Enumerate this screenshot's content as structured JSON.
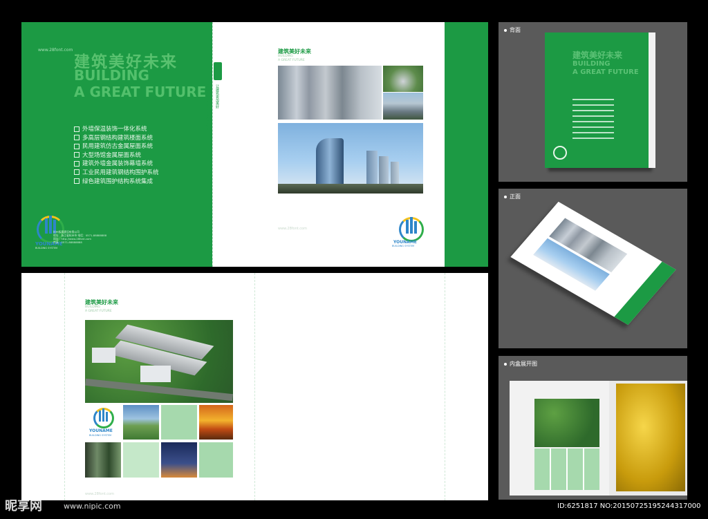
{
  "cover": {
    "url": "www.28font.com",
    "cn_title": "建筑美好未来",
    "en_line1": "BUILDING",
    "en_line2": "A GREAT FUTURE",
    "features": [
      "外墙保温装饰一体化系统",
      "多高层钢结构建筑楼面系统",
      "民用建筑仿古金属屋面系统",
      "大型场馆金属屋面系统",
      "建筑外墙金属装饰幕墙系统",
      "工业民用建筑钢结构围护系统",
      "绿色建筑围护结构系统集成"
    ],
    "brand": "YOUNAME",
    "brand_sub": "BUILDING SYSTEM",
    "company_lines": [
      "杭州板康建设有限公司",
      "地址：浙江省杭州市 电话：0571-88888888",
      "网址：http://www.28font.com",
      "传真：0571-88888888"
    ]
  },
  "spine": {
    "text_cn": "让建筑更加美好",
    "text_en": "Let the building speaking for you"
  },
  "front": {
    "cn_title": "建筑美好未来",
    "en_line1": "BUILDING",
    "en_line2": "A GREAT FUTURE",
    "url": "www.28font.com",
    "brand": "YOUNAME",
    "brand_sub": "BUILDING SYSTEM"
  },
  "inner": {
    "cn_title": "建筑美好未来",
    "en_line1": "BUILDING",
    "en_line2": "A GREAT FUTURE",
    "brand": "YOUNAME",
    "brand_sub": "BUILDING SYSTEM",
    "url": "www.28font.com"
  },
  "panels": {
    "back_label": "背面",
    "front_label": "正面",
    "open_label": "内盒展开图"
  },
  "mockup": {
    "cn_title": "建筑美好未来",
    "en_line1": "BUILDING",
    "en_line2": "A GREAT FUTURE"
  },
  "watermark": {
    "brand": "昵享网",
    "url": "www.nipic.com",
    "id": "ID:6251817 NO:20150725195244317000"
  },
  "colors": {
    "green": "#1c9a44",
    "blue": "#2e86c9",
    "background": "#000000",
    "panel": "#5a5a5a"
  }
}
